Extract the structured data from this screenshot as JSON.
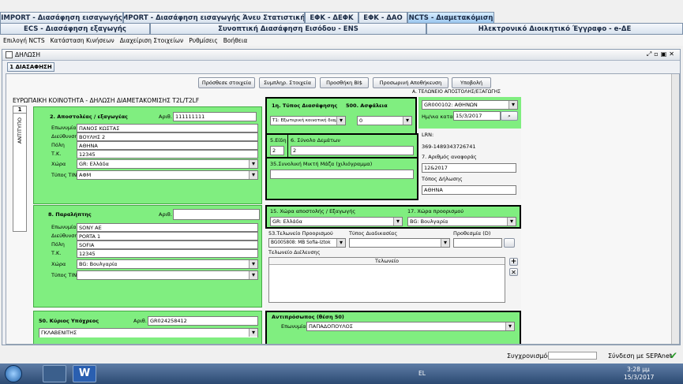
{
  "tabs_row1": [
    "IMPORT - Διασάφηση εισαγωγής",
    "IMPORT - Διασάφηση εισαγωγής Άνευ Στατιστικής",
    "ΕΦΚ - ΔΕΦΚ",
    "ΕΦΚ - ΔΑΟ",
    "NCTS - Διαμετακόμιση"
  ],
  "tabs_row2": [
    "ECS - Διασάφηση εξαγωγής",
    "Συνοπτική Διασάφηση Εισόδου - ENS",
    "Ηλεκτρονικό Διοικητικό Έγγραφο - e-ΔΕ"
  ],
  "menu": [
    "Επιλογή NCTS",
    "Κατάσταση Κινήσεων",
    "Διαχείριση Στοιχείων",
    "Ρυθμίσεις",
    "Βοήθεια"
  ],
  "window_title": "ΔΗΛΩΣΗ",
  "subtab": "1 ΔΙΑΣΑΦΗΣΗ",
  "buttons": [
    "Πρόσθεσε στοιχεία",
    "Συμπληρ. Στοιχεία",
    "Προσθήκη BI$",
    "Προσωρινή Αποθήκευση",
    "Υποβολή"
  ],
  "header": "ΕΥΡΩΠΑΙΚΗ ΚΟΙΝΟΤΗΤΑ - ΔΗΛΩΣΗ ΔΙΑΜΕΤΑΚΟΜΙΣΗΣ T2L/T2LF",
  "header_right": "Α. ΤΕΛΩΝΕΙΟ ΑΠΟΣΤΟΛΗΣ/ΕΞΑΓΩΓΗΣ",
  "copy_no": "1",
  "copy_label": "ΑΝΤΙΤΥΠΟ",
  "sender": {
    "title": "2. Αποστολέας / εξαγωγέας",
    "arith_label": "Αριθ.",
    "arith": "111111111",
    "name_l": "Επωνυμία",
    "name": "ΠΑΝΟΣ ΚΩΣΤΑΣ",
    "addr_l": "Διεύθυνση",
    "addr": "ΒΟΥΛΗΣ 2",
    "city_l": "Πόλη",
    "city": "ΑΘΗΝΑ",
    "zip_l": "Τ.Κ.",
    "zip": "12345",
    "country_l": "Χώρα",
    "country": "GR: Ελλάδα",
    "tin_l": "Τύπος TIN",
    "tin": "ΑΦΜ"
  },
  "decl": {
    "type_l": "1η. Τύπος Διασάφησης",
    "sec_l": "500. Ασφάλεια",
    "type": "T1: Εξωτερική κοινοτική διαμετ",
    "sec": "0"
  },
  "office": {
    "val": "GR000102: ΑΘΗΝΩΝ",
    "date_l": "Ημ/νια καταχ.",
    "date": "15/3/2017",
    "lrn_l": "LRN:",
    "lrn": "369-1489343726741",
    "ref_l": "7. Αριθμός αναφοράς",
    "ref": "12&2017",
    "place_l": "Τόπος Δήλωσης",
    "place": "AΘHNA"
  },
  "items": {
    "l5": "5.Είδη",
    "v5": "2",
    "l6": "6. Σύνολο Δεμάτων",
    "v6": "2",
    "l35": "35.Συνολική Μικτή Μάζα (χιλιόγραμμα)"
  },
  "consignee": {
    "title": "8. Παραλήπτης",
    "arith_label": "Αριθ.",
    "name": "SONY AE",
    "addr": "PORTA 1",
    "city": "SOFIA",
    "zip": "12345",
    "country": "BG: Βουλγαρία",
    "tin": ""
  },
  "route": {
    "l15": "15. Χώρα αποστολής / Εξαγωγής",
    "v15": "GR: Ελλάδα",
    "l17": "17. Χώρα προορισμού",
    "v17": "BG: Βουλγαρία",
    "l53": "53.Τελωνείο Προορισμού",
    "v53": "BG005808: MB Sofia-Iztok",
    "proc_l": "Τύπος Διαδικασίας",
    "dead_l": "Προθεσμία (D)",
    "transit_l": "Τελωνείο Διέλευσης",
    "col_l": "Τελωνείο"
  },
  "principal": {
    "title": "50. Κύριος Υπόχρεος",
    "arith_label": "Αριθ.",
    "arith": "GR024258412",
    "name": "ΓΚΛΑΒΕΝΙΤΗΣ"
  },
  "rep": {
    "title": "Αντιπρόσωπος (θέση 50)",
    "name_l": "Επωνυμία",
    "name": "ΠΑΠΑΔΟΠΟΥΛΟΣ"
  },
  "status": {
    "sync": "Συγχρονισμός",
    "conn": "Σύνδεση με SEPAnet"
  },
  "tray": {
    "lang": "EL",
    "time": "3:28 μμ",
    "date": "15/3/2017"
  }
}
